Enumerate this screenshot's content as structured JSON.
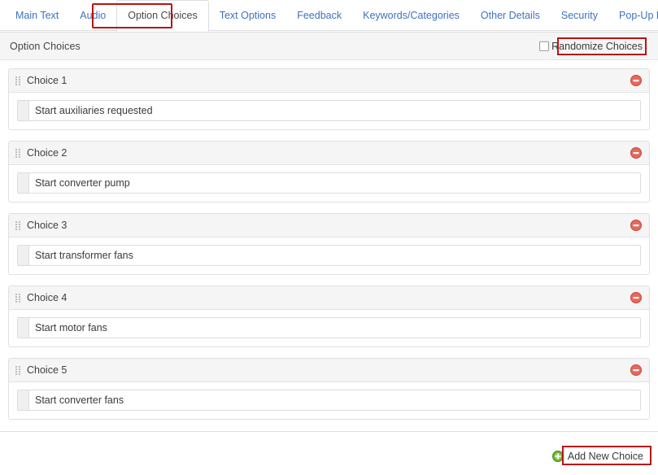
{
  "tabs": {
    "items": [
      {
        "label": "Main Text",
        "active": false
      },
      {
        "label": "Audio",
        "active": false
      },
      {
        "label": "Option Choices",
        "active": true
      },
      {
        "label": "Text Options",
        "active": false
      },
      {
        "label": "Feedback",
        "active": false
      },
      {
        "label": "Keywords/Categories",
        "active": false
      },
      {
        "label": "Other Details",
        "active": false
      },
      {
        "label": "Security",
        "active": false
      },
      {
        "label": "Pop-Up Boxes",
        "active": false
      }
    ]
  },
  "panel": {
    "title": "Option Choices",
    "randomize": {
      "label": "Randomize Choices",
      "checked": false
    }
  },
  "choices": [
    {
      "label": "Choice 1",
      "value": "Start auxiliaries requested",
      "placeholder": ""
    },
    {
      "label": "Choice 2",
      "value": "Start converter pump",
      "placeholder": ""
    },
    {
      "label": "Choice 3",
      "value": "Start transformer fans",
      "placeholder": ""
    },
    {
      "label": "Choice 4",
      "value": "Start motor fans",
      "placeholder": ""
    },
    {
      "label": "Choice 5",
      "value": "Start converter fans",
      "placeholder": ""
    }
  ],
  "footer": {
    "add_new_label": "Add New Choice"
  },
  "icons": {
    "grip": "drag-handle-icon",
    "remove": "remove-circle-icon",
    "add": "add-circle-icon",
    "checkbox": "checkbox-icon"
  },
  "colors": {
    "tab_link": "#3d72c0",
    "tab_active_text": "#4a4a4a",
    "annotation_red": "#b81414",
    "remove_red": "#e8685b",
    "add_green": "#66b032",
    "panel_gray": "#f5f5f5",
    "border_gray": "#e0e0e0"
  }
}
